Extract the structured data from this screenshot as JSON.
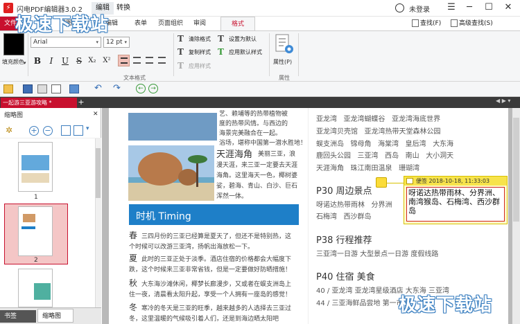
{
  "app": {
    "title": "闪电PDF编辑器3.0.2",
    "ctx_edit": "编辑",
    "ctx_convert": "转换",
    "login": "未登录",
    "win_controls": [
      "☰",
      "─",
      "☐",
      "✕"
    ]
  },
  "ribbon_tabs": [
    "文件",
    "视图",
    "编辑",
    "表单",
    "页面组织",
    "审阅",
    "格式"
  ],
  "ribbon_right": {
    "find": "查找(F)",
    "adv_find": "高级查找(S)"
  },
  "format": {
    "fill_label": "填充颜色",
    "font": "Arial",
    "size": "12 pt",
    "group_text_label": "文本格式",
    "group_prop_label": "属性",
    "props_label": "属性(P)",
    "buttons": [
      "清除格式",
      "复制样式",
      "应用样式",
      "设置为默认",
      "应用默认样式"
    ],
    "styles": [
      "B",
      "I",
      "U",
      "S",
      "X₂",
      "X²"
    ]
  },
  "doc_tab": {
    "label": "一起游三亚游攻略 *",
    "add": "+"
  },
  "left_panel": {
    "title": "缩略图",
    "pages": [
      "1",
      "2",
      "3"
    ],
    "tabs": [
      "书签",
      "缩略图"
    ]
  },
  "page_left": {
    "top_text": "艺、赖埔等的热带植物被",
    "top_lines": [
      "度的热带风情。与西边的",
      "海景完美融合在一起。",
      "浴场，堪称中国第一潜水胜地！"
    ],
    "tianya_title": "天涯海角",
    "tianya_sub": "美丽三亚，浪",
    "tianya_lines": [
      "漫天涯，来三亚一定要去天涯",
      "海角。这里海天一色，椰树婆",
      "娑，碧海、青山、白沙、巨石",
      "浑然一体。"
    ],
    "timing": "时机  Timing",
    "seasons": [
      {
        "k": "春",
        "l1": "三四月份的三亚已经算是夏天了，但还不是特别热，这",
        "l2": "个时候可以改游三亚湾，扬帆出海放松一下。"
      },
      {
        "k": "夏",
        "l1": "此时的三亚正处于淡季。酒店住宿的价格都会大幅度下",
        "l2": "跌，这个时候来三亚非常省钱，但是一定要做好防晒措施！"
      },
      {
        "k": "秋",
        "l1": "大东海沙滩休闲，椰梦长廊漫步，又或者在蜈支洲岛上",
        "l2": "住一夜，清晨看太阳升起，享受一个人拥有一座岛的感觉！"
      },
      {
        "k": "冬",
        "l1": "寒冷的冬天是三亚的旺季，越来越多的人选择去三亚过",
        "l2": "冬，这里温暖的气候吸引着人们，还是到海边晒太阳吧"
      }
    ]
  },
  "page_right": {
    "spots": [
      [
        "亚龙湾",
        "亚龙湾蝴蝶谷",
        "亚龙湾海底世界"
      ],
      [
        "亚龙湾贝壳馆",
        "亚龙湾热带天堂森林公园"
      ],
      [
        "蜈支洲岛",
        "锦母角",
        "海棠湾",
        "皇后湾",
        "大东海"
      ],
      [
        "鹿回头公园",
        "三亚湾",
        "西岛",
        "南山",
        "大小洞天"
      ],
      [
        "天涯海角",
        "珠江南田温泉",
        "珊瑚湾"
      ]
    ],
    "p30": "P30  周边景点",
    "p30_lines": [
      "呀诺达热带雨林",
      "分界洲",
      "石梅湾",
      "西沙群岛"
    ],
    "p38": "P38  行程推荐",
    "p38_line": "三亚湾一日游    大型景点一日游    度假线路",
    "p40": "P40  住宿  美食",
    "p40_lines": [
      "40 / 亚龙湾    亚龙湾星级酒店    大东海    三亚湾",
      "44 / 三亚海鲜品尝地    第一市场"
    ]
  },
  "note": {
    "head": "便签 2018-10-18, 11:33:03",
    "body": "呀诺达热带雨林、分界洲、南湾猴岛、石梅湾、西沙群岛"
  },
  "watermark": "极速下载站"
}
